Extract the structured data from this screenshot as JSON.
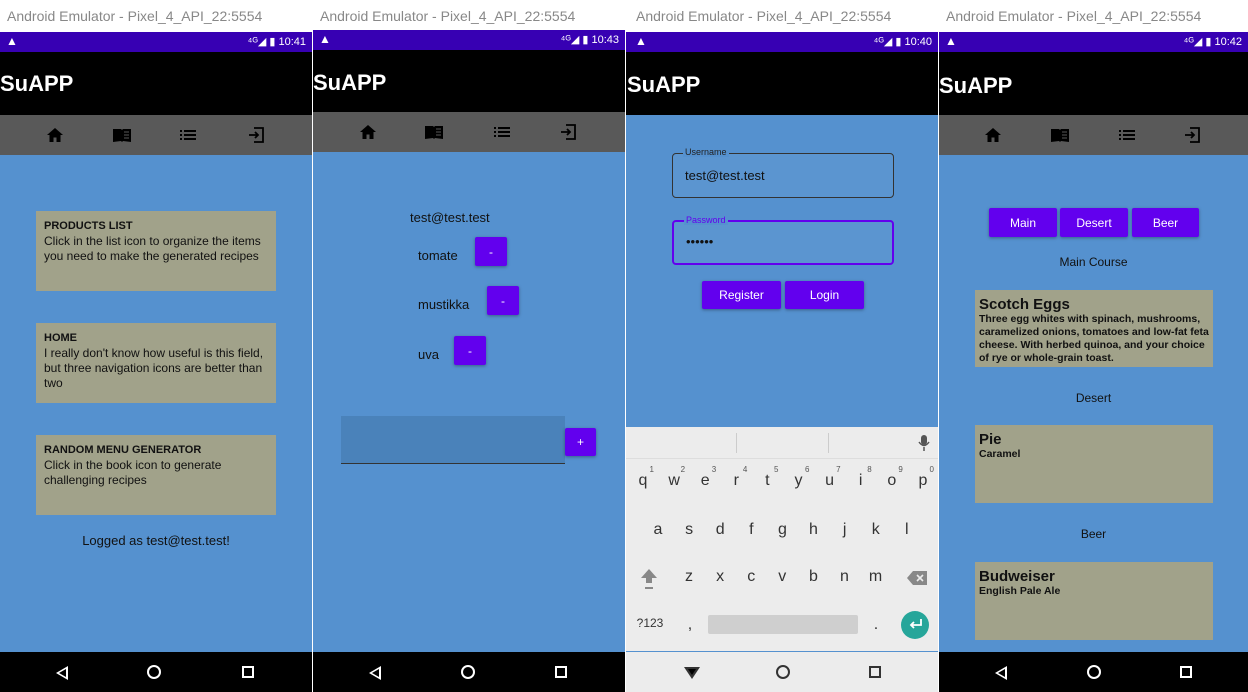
{
  "emulator_title": "Android Emulator - Pixel_4_API_22:5554",
  "app_title": "SuAPP",
  "screens": {
    "home": {
      "time": "10:41",
      "cards": [
        {
          "title": "PRODUCTS LIST",
          "text": "Click in the list icon to organize the items you need to make the generated recipes"
        },
        {
          "title": "HOME",
          "text": "I really don't know how useful is this field, but three navigation icons are better than two"
        },
        {
          "title": "RANDOM MENU GENERATOR",
          "text": "Click in the book icon to generate challenging recipes"
        }
      ],
      "logged_as": "Logged as test@test.test!"
    },
    "products": {
      "time": "10:43",
      "user": "test@test.test",
      "items": [
        {
          "name": "tomate",
          "remove_label": "-"
        },
        {
          "name": "mustikka",
          "remove_label": "-"
        },
        {
          "name": "uva",
          "remove_label": "-"
        }
      ],
      "new_item_value": "",
      "add_label": "+"
    },
    "login": {
      "time": "10:40",
      "username_label": "Username",
      "username_value": "test@test.test",
      "password_label": "Password",
      "password_value": "••••••",
      "register_label": "Register",
      "login_label": "Login",
      "keyboard": {
        "row1": [
          "q",
          "w",
          "e",
          "r",
          "t",
          "y",
          "u",
          "i",
          "o",
          "p"
        ],
        "row1_hints": [
          "1",
          "2",
          "3",
          "4",
          "5",
          "6",
          "7",
          "8",
          "9",
          "0"
        ],
        "row2": [
          "a",
          "s",
          "d",
          "f",
          "g",
          "h",
          "j",
          "k",
          "l"
        ],
        "row3": [
          "z",
          "x",
          "c",
          "v",
          "b",
          "n",
          "m"
        ],
        "symbols_key": "?123",
        "comma_key": ",",
        "period_key": "."
      }
    },
    "menu": {
      "time": "10:42",
      "filter_buttons": [
        "Main",
        "Desert",
        "Beer"
      ],
      "sections": [
        {
          "heading": "Main Course",
          "name": "Scotch Eggs",
          "desc": "Three egg whites with spinach, mushrooms, caramelized onions, tomatoes and low-fat feta cheese. With herbed quinoa, and your choice of rye or whole-grain toast."
        },
        {
          "heading": "Desert",
          "name": "Pie",
          "desc": "Caramel"
        },
        {
          "heading": "Beer",
          "name": "Budweiser",
          "desc": "English Pale Ale"
        }
      ]
    }
  },
  "colors": {
    "status_bar": "#3700b3",
    "accent": "#6200ee",
    "background": "#5591cf",
    "card": "#a1a28a",
    "tab_bar": "#595959"
  }
}
